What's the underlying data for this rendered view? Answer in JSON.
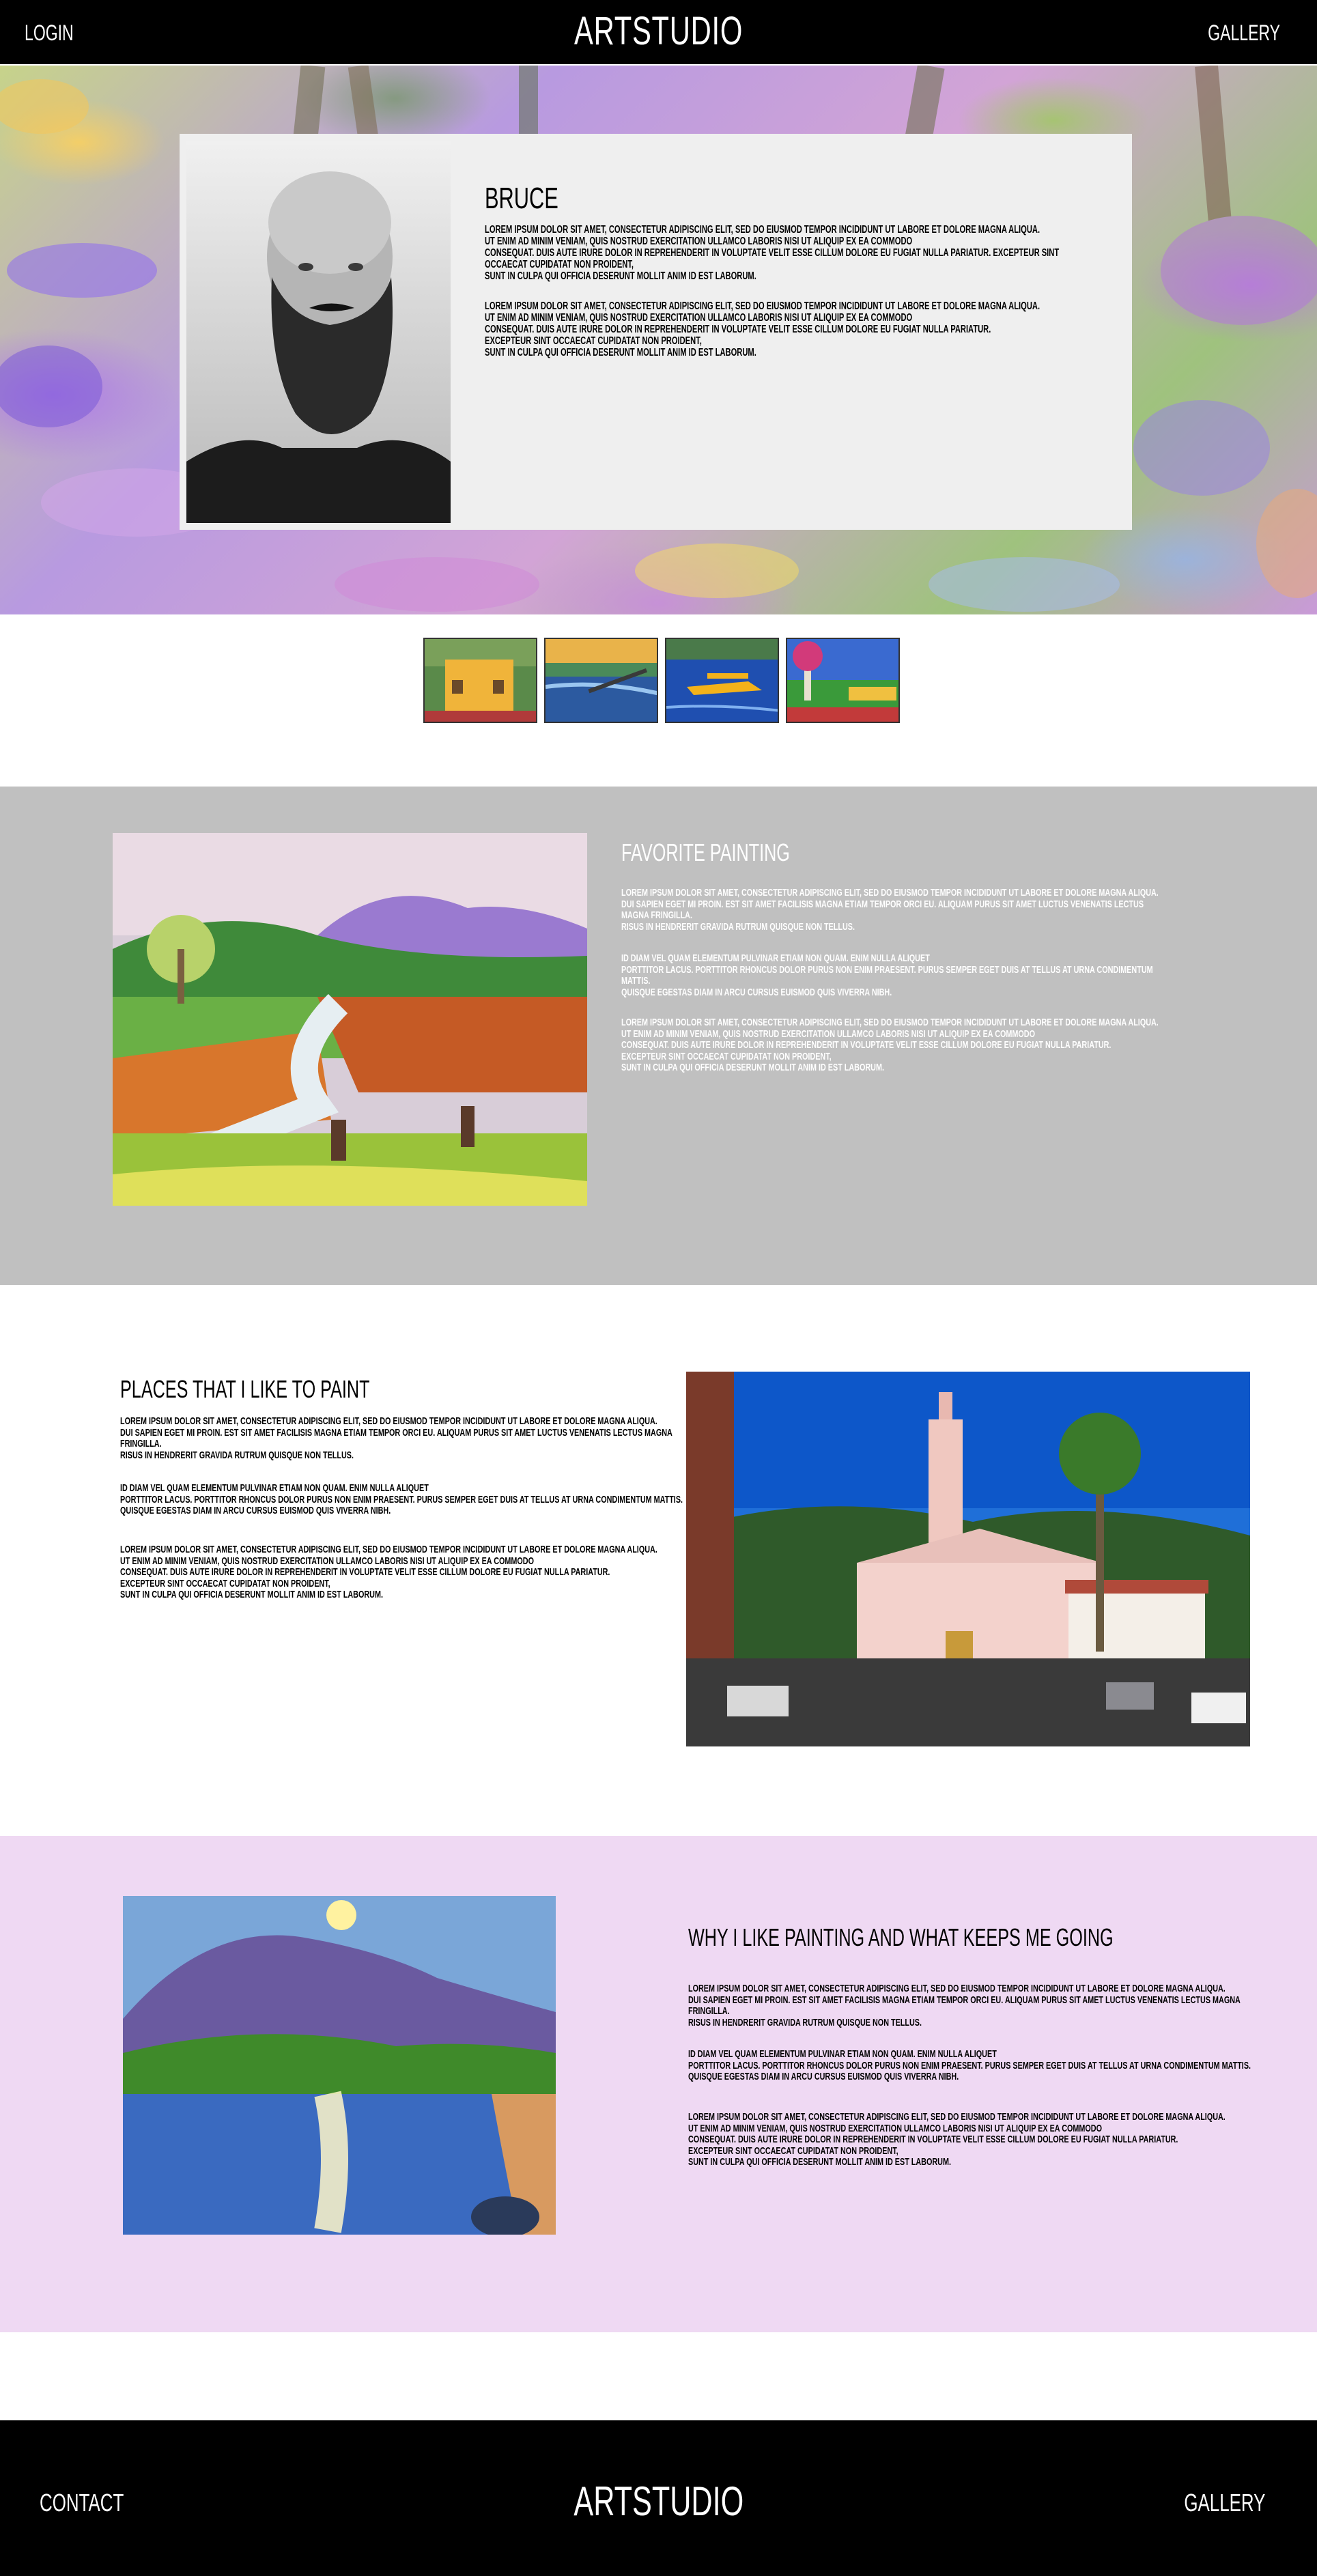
{
  "header": {
    "login_label": "LOGIN",
    "logo_text": "ARTSTUDIO",
    "gallery_label": "GALLERY"
  },
  "hero": {
    "name": "BRUCE",
    "bio_paragraph_1": "LOREM IPSUM DOLOR SIT AMET, CONSECTETUR ADIPISCING ELIT, SED DO EIUSMOD TEMPOR INCIDIDUNT UT LABORE ET DOLORE MAGNA ALIQUA.\n UT ENIM AD MINIM VENIAM, QUIS NOSTRUD EXERCITATION ULLAMCO LABORIS NISI UT ALIQUIP EX EA COMMODO\nCONSEQUAT. DUIS AUTE IRURE DOLOR IN REPREHENDERIT IN VOLUPTATE VELIT ESSE CILLUM DOLORE EU FUGIAT NULLA PARIATUR. EXCEPTEUR SINT OCCAECAT CUPIDATAT NON PROIDENT,\nSUNT IN CULPA QUI OFFICIA DESERUNT MOLLIT ANIM ID EST LABORUM.",
    "bio_paragraph_2": "LOREM IPSUM DOLOR SIT AMET, CONSECTETUR ADIPISCING ELIT, SED DO EIUSMOD TEMPOR INCIDIDUNT UT LABORE ET DOLORE MAGNA ALIQUA.\n UT ENIM AD MINIM VENIAM, QUIS NOSTRUD EXERCITATION ULLAMCO LABORIS NISI UT ALIQUIP EX EA COMMODO\nCONSEQUAT. DUIS AUTE IRURE DOLOR IN REPREHENDERIT IN VOLUPTATE VELIT ESSE CILLUM DOLORE EU FUGIAT NULLA PARIATUR.\nEXCEPTEUR SINT OCCAECAT CUPIDATAT NON PROIDENT,\nSUNT IN CULPA QUI OFFICIA DESERUNT MOLLIT ANIM ID EST LABORUM."
  },
  "favorite": {
    "title": "FAVORITE PAINTING",
    "paragraph_1": "LOREM IPSUM DOLOR SIT AMET, CONSECTETUR ADIPISCING ELIT, SED DO EIUSMOD TEMPOR INCIDIDUNT UT LABORE ET DOLORE MAGNA ALIQUA.\n DUI SAPIEN EGET MI PROIN. EST SIT AMET FACILISIS MAGNA ETIAM TEMPOR ORCI EU. ALIQUAM PURUS SIT AMET LUCTUS VENENATIS LECTUS MAGNA FRINGILLA.\n RISUS IN HENDRERIT GRAVIDA RUTRUM QUISQUE NON TELLUS.",
    "paragraph_2": " ID DIAM VEL QUAM ELEMENTUM PULVINAR ETIAM NON QUAM. ENIM NULLA ALIQUET\nPORTTITOR LACUS. PORTTITOR RHONCUS DOLOR PURUS NON ENIM PRAESENT. PURUS SEMPER EGET DUIS AT TELLUS AT URNA CONDIMENTUM MATTIS.\nQUISQUE EGESTAS DIAM IN ARCU CURSUS EUISMOD QUIS VIVERRA NIBH.",
    "paragraph_3": "LOREM IPSUM DOLOR SIT AMET, CONSECTETUR ADIPISCING ELIT, SED DO EIUSMOD TEMPOR INCIDIDUNT UT LABORE ET DOLORE MAGNA ALIQUA.\n UT ENIM AD MINIM VENIAM, QUIS NOSTRUD EXERCITATION ULLAMCO LABORIS NISI UT ALIQUIP EX EA COMMODO\nCONSEQUAT. DUIS AUTE IRURE DOLOR IN REPREHENDERIT IN VOLUPTATE VELIT ESSE CILLUM DOLORE EU FUGIAT NULLA PARIATUR.\nEXCEPTEUR SINT OCCAECAT CUPIDATAT NON PROIDENT,\nSUNT IN CULPA QUI OFFICIA DESERUNT MOLLIT ANIM ID EST LABORUM."
  },
  "places": {
    "title": "PLACES THAT I LIKE TO PAINT",
    "paragraph_1": "LOREM IPSUM DOLOR SIT AMET, CONSECTETUR ADIPISCING ELIT, SED DO EIUSMOD TEMPOR INCIDIDUNT UT LABORE ET DOLORE MAGNA ALIQUA.\n DUI SAPIEN EGET MI PROIN. EST SIT AMET FACILISIS MAGNA ETIAM TEMPOR ORCI EU. ALIQUAM PURUS SIT AMET LUCTUS VENENATIS LECTUS MAGNA FRINGILLA.\n RISUS IN HENDRERIT GRAVIDA RUTRUM QUISQUE NON TELLUS.",
    "paragraph_2": " ID DIAM VEL QUAM ELEMENTUM PULVINAR ETIAM NON QUAM. ENIM NULLA ALIQUET\nPORTTITOR LACUS. PORTTITOR RHONCUS DOLOR PURUS NON ENIM PRAESENT. PURUS SEMPER EGET DUIS AT TELLUS AT URNA CONDIMENTUM MATTIS.\nQUISQUE EGESTAS DIAM IN ARCU CURSUS EUISMOD QUIS VIVERRA NIBH.",
    "paragraph_3": "LOREM IPSUM DOLOR SIT AMET, CONSECTETUR ADIPISCING ELIT, SED DO EIUSMOD TEMPOR INCIDIDUNT UT LABORE ET DOLORE MAGNA ALIQUA.\n UT ENIM AD MINIM VENIAM, QUIS NOSTRUD EXERCITATION ULLAMCO LABORIS NISI UT ALIQUIP EX EA COMMODO\nCONSEQUAT. DUIS AUTE IRURE DOLOR IN REPREHENDERIT IN VOLUPTATE VELIT ESSE CILLUM DOLORE EU FUGIAT NULLA PARIATUR.\nEXCEPTEUR SINT OCCAECAT CUPIDATAT NON PROIDENT,\nSUNT IN CULPA QUI OFFICIA DESERUNT MOLLIT ANIM ID EST LABORUM."
  },
  "why": {
    "title": "WHY I LIKE PAINTING AND WHAT KEEPS ME GOING",
    "paragraph_1": "LOREM IPSUM DOLOR SIT AMET, CONSECTETUR ADIPISCING ELIT, SED DO EIUSMOD TEMPOR INCIDIDUNT UT LABORE ET DOLORE MAGNA ALIQUA.\n DUI SAPIEN EGET MI PROIN. EST SIT AMET FACILISIS MAGNA ETIAM TEMPOR ORCI EU. ALIQUAM PURUS SIT AMET LUCTUS VENENATIS LECTUS MAGNA FRINGILLA.\n RISUS IN HENDRERIT GRAVIDA RUTRUM QUISQUE NON TELLUS.",
    "paragraph_2": " ID DIAM VEL QUAM ELEMENTUM PULVINAR ETIAM NON QUAM. ENIM NULLA ALIQUET\nPORTTITOR LACUS. PORTTITOR RHONCUS DOLOR PURUS NON ENIM PRAESENT. PURUS SEMPER EGET DUIS AT TELLUS AT URNA CONDIMENTUM MATTIS.\nQUISQUE EGESTAS DIAM IN ARCU CURSUS EUISMOD QUIS VIVERRA NIBH.",
    "paragraph_3": "LOREM IPSUM DOLOR SIT AMET, CONSECTETUR ADIPISCING ELIT, SED DO EIUSMOD TEMPOR INCIDIDUNT UT LABORE ET DOLORE MAGNA ALIQUA.\n UT ENIM AD MINIM VENIAM, QUIS NOSTRUD EXERCITATION ULLAMCO LABORIS NISI UT ALIQUIP EX EA COMMODO\nCONSEQUAT. DUIS AUTE IRURE DOLOR IN REPREHENDERIT IN VOLUPTATE VELIT ESSE CILLUM DOLORE EU FUGIAT NULLA PARIATUR.\nEXCEPTEUR SINT OCCAECAT CUPIDATAT NON PROIDENT,\nSUNT IN CULPA QUI OFFICIA DESERUNT MOLLIT ANIM ID EST LABORUM."
  },
  "footer": {
    "contact_label": "CONTACT",
    "logo_text": "ARTSTUDIO",
    "gallery_label": "GALLERY"
  },
  "colors": {
    "header_bg": "#000000",
    "favorite_bg": "#c0c0c0",
    "why_bg": "#efd9f3",
    "card_bg": "#efefef"
  }
}
